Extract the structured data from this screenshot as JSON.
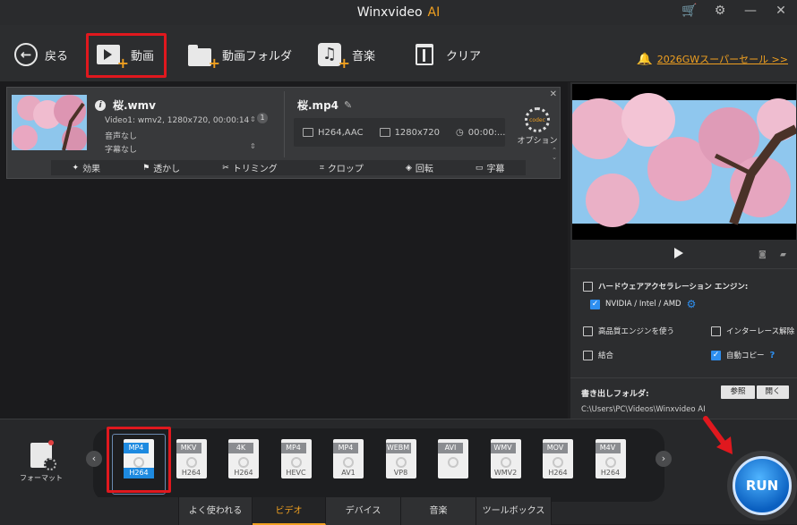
{
  "window": {
    "title": "Winxvideo",
    "title_ai": "AI"
  },
  "toolbar": {
    "back_label": "戻る",
    "video_label": "動画",
    "video_folder_label": "動画フォルダ",
    "music_label": "音楽",
    "clear_label": "クリア",
    "promo_label": "2026GWスーパーセール >>"
  },
  "task": {
    "source_name": "桜.wmv",
    "video_info": "Video1: wmv2, 1280x720, 00:00:14",
    "audio_info": "音声なし",
    "subtitle_info": "字幕なし",
    "track_count": "1",
    "output_name": "桜.mp4",
    "codec": "H264,AAC",
    "resolution": "1280x720",
    "duration": "00:00:...",
    "option_label": "オプション",
    "edit_tools": [
      "効果",
      "透かし",
      "トリミング",
      "クロップ",
      "回転",
      "字幕"
    ]
  },
  "settings": {
    "hw_accel": "ハードウェアアクセラレーション エンジン:",
    "hw_vendor": "NVIDIA / Intel / AMD",
    "hq_engine": "高品質エンジンを使う",
    "deinterlace": "インターレース解除",
    "merge": "結合",
    "autocopy": "自動コピー",
    "autocopy_help": "?",
    "output_folder_label": "書き出しフォルダ:",
    "output_path": "C:\\Users\\PC\\Videos\\Winxvideo AI",
    "browse_button": "参照",
    "open_button": "開く"
  },
  "formats": {
    "format_label": "フォーマット",
    "items": [
      {
        "top": "MP4",
        "sub": "H264",
        "selected": true
      },
      {
        "top": "MKV",
        "sub": "H264",
        "selected": false
      },
      {
        "top": "4K",
        "sub": "H264",
        "selected": false
      },
      {
        "top": "MP4",
        "sub": "HEVC",
        "selected": false
      },
      {
        "top": "MP4",
        "sub": "AV1",
        "selected": false
      },
      {
        "top": "WEBM",
        "sub": "VP8",
        "selected": false
      },
      {
        "top": "AVI",
        "sub": "",
        "selected": false
      },
      {
        "top": "WMV",
        "sub": "WMV2",
        "selected": false
      },
      {
        "top": "MOV",
        "sub": "H264",
        "selected": false
      },
      {
        "top": "M4V",
        "sub": "H264",
        "selected": false
      }
    ]
  },
  "tabs": [
    "よく使われる",
    "ビデオ",
    "デバイス",
    "音楽",
    "ツールボックス"
  ],
  "active_tab": "ビデオ",
  "run_label": "RUN",
  "colors": {
    "accent": "#f0a020",
    "highlight_red": "#e0181e",
    "run_blue": "#1e8ae0"
  },
  "icons": {
    "cart": "cart-icon",
    "gear": "gear-icon",
    "minimize": "minimize-icon",
    "close": "close-icon",
    "bell": "bell-icon"
  }
}
